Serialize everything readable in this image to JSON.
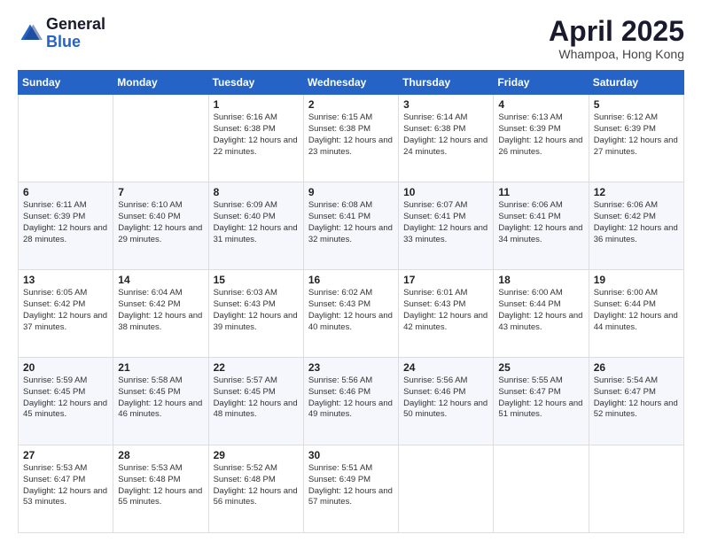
{
  "logo": {
    "general": "General",
    "blue": "Blue"
  },
  "title": "April 2025",
  "location": "Whampoa, Hong Kong",
  "days_of_week": [
    "Sunday",
    "Monday",
    "Tuesday",
    "Wednesday",
    "Thursday",
    "Friday",
    "Saturday"
  ],
  "weeks": [
    [
      {
        "day": "",
        "sunrise": "",
        "sunset": "",
        "daylight": ""
      },
      {
        "day": "",
        "sunrise": "",
        "sunset": "",
        "daylight": ""
      },
      {
        "day": "1",
        "sunrise": "Sunrise: 6:16 AM",
        "sunset": "Sunset: 6:38 PM",
        "daylight": "Daylight: 12 hours and 22 minutes."
      },
      {
        "day": "2",
        "sunrise": "Sunrise: 6:15 AM",
        "sunset": "Sunset: 6:38 PM",
        "daylight": "Daylight: 12 hours and 23 minutes."
      },
      {
        "day": "3",
        "sunrise": "Sunrise: 6:14 AM",
        "sunset": "Sunset: 6:38 PM",
        "daylight": "Daylight: 12 hours and 24 minutes."
      },
      {
        "day": "4",
        "sunrise": "Sunrise: 6:13 AM",
        "sunset": "Sunset: 6:39 PM",
        "daylight": "Daylight: 12 hours and 26 minutes."
      },
      {
        "day": "5",
        "sunrise": "Sunrise: 6:12 AM",
        "sunset": "Sunset: 6:39 PM",
        "daylight": "Daylight: 12 hours and 27 minutes."
      }
    ],
    [
      {
        "day": "6",
        "sunrise": "Sunrise: 6:11 AM",
        "sunset": "Sunset: 6:39 PM",
        "daylight": "Daylight: 12 hours and 28 minutes."
      },
      {
        "day": "7",
        "sunrise": "Sunrise: 6:10 AM",
        "sunset": "Sunset: 6:40 PM",
        "daylight": "Daylight: 12 hours and 29 minutes."
      },
      {
        "day": "8",
        "sunrise": "Sunrise: 6:09 AM",
        "sunset": "Sunset: 6:40 PM",
        "daylight": "Daylight: 12 hours and 31 minutes."
      },
      {
        "day": "9",
        "sunrise": "Sunrise: 6:08 AM",
        "sunset": "Sunset: 6:41 PM",
        "daylight": "Daylight: 12 hours and 32 minutes."
      },
      {
        "day": "10",
        "sunrise": "Sunrise: 6:07 AM",
        "sunset": "Sunset: 6:41 PM",
        "daylight": "Daylight: 12 hours and 33 minutes."
      },
      {
        "day": "11",
        "sunrise": "Sunrise: 6:06 AM",
        "sunset": "Sunset: 6:41 PM",
        "daylight": "Daylight: 12 hours and 34 minutes."
      },
      {
        "day": "12",
        "sunrise": "Sunrise: 6:06 AM",
        "sunset": "Sunset: 6:42 PM",
        "daylight": "Daylight: 12 hours and 36 minutes."
      }
    ],
    [
      {
        "day": "13",
        "sunrise": "Sunrise: 6:05 AM",
        "sunset": "Sunset: 6:42 PM",
        "daylight": "Daylight: 12 hours and 37 minutes."
      },
      {
        "day": "14",
        "sunrise": "Sunrise: 6:04 AM",
        "sunset": "Sunset: 6:42 PM",
        "daylight": "Daylight: 12 hours and 38 minutes."
      },
      {
        "day": "15",
        "sunrise": "Sunrise: 6:03 AM",
        "sunset": "Sunset: 6:43 PM",
        "daylight": "Daylight: 12 hours and 39 minutes."
      },
      {
        "day": "16",
        "sunrise": "Sunrise: 6:02 AM",
        "sunset": "Sunset: 6:43 PM",
        "daylight": "Daylight: 12 hours and 40 minutes."
      },
      {
        "day": "17",
        "sunrise": "Sunrise: 6:01 AM",
        "sunset": "Sunset: 6:43 PM",
        "daylight": "Daylight: 12 hours and 42 minutes."
      },
      {
        "day": "18",
        "sunrise": "Sunrise: 6:00 AM",
        "sunset": "Sunset: 6:44 PM",
        "daylight": "Daylight: 12 hours and 43 minutes."
      },
      {
        "day": "19",
        "sunrise": "Sunrise: 6:00 AM",
        "sunset": "Sunset: 6:44 PM",
        "daylight": "Daylight: 12 hours and 44 minutes."
      }
    ],
    [
      {
        "day": "20",
        "sunrise": "Sunrise: 5:59 AM",
        "sunset": "Sunset: 6:45 PM",
        "daylight": "Daylight: 12 hours and 45 minutes."
      },
      {
        "day": "21",
        "sunrise": "Sunrise: 5:58 AM",
        "sunset": "Sunset: 6:45 PM",
        "daylight": "Daylight: 12 hours and 46 minutes."
      },
      {
        "day": "22",
        "sunrise": "Sunrise: 5:57 AM",
        "sunset": "Sunset: 6:45 PM",
        "daylight": "Daylight: 12 hours and 48 minutes."
      },
      {
        "day": "23",
        "sunrise": "Sunrise: 5:56 AM",
        "sunset": "Sunset: 6:46 PM",
        "daylight": "Daylight: 12 hours and 49 minutes."
      },
      {
        "day": "24",
        "sunrise": "Sunrise: 5:56 AM",
        "sunset": "Sunset: 6:46 PM",
        "daylight": "Daylight: 12 hours and 50 minutes."
      },
      {
        "day": "25",
        "sunrise": "Sunrise: 5:55 AM",
        "sunset": "Sunset: 6:47 PM",
        "daylight": "Daylight: 12 hours and 51 minutes."
      },
      {
        "day": "26",
        "sunrise": "Sunrise: 5:54 AM",
        "sunset": "Sunset: 6:47 PM",
        "daylight": "Daylight: 12 hours and 52 minutes."
      }
    ],
    [
      {
        "day": "27",
        "sunrise": "Sunrise: 5:53 AM",
        "sunset": "Sunset: 6:47 PM",
        "daylight": "Daylight: 12 hours and 53 minutes."
      },
      {
        "day": "28",
        "sunrise": "Sunrise: 5:53 AM",
        "sunset": "Sunset: 6:48 PM",
        "daylight": "Daylight: 12 hours and 55 minutes."
      },
      {
        "day": "29",
        "sunrise": "Sunrise: 5:52 AM",
        "sunset": "Sunset: 6:48 PM",
        "daylight": "Daylight: 12 hours and 56 minutes."
      },
      {
        "day": "30",
        "sunrise": "Sunrise: 5:51 AM",
        "sunset": "Sunset: 6:49 PM",
        "daylight": "Daylight: 12 hours and 57 minutes."
      },
      {
        "day": "",
        "sunrise": "",
        "sunset": "",
        "daylight": ""
      },
      {
        "day": "",
        "sunrise": "",
        "sunset": "",
        "daylight": ""
      },
      {
        "day": "",
        "sunrise": "",
        "sunset": "",
        "daylight": ""
      }
    ]
  ]
}
